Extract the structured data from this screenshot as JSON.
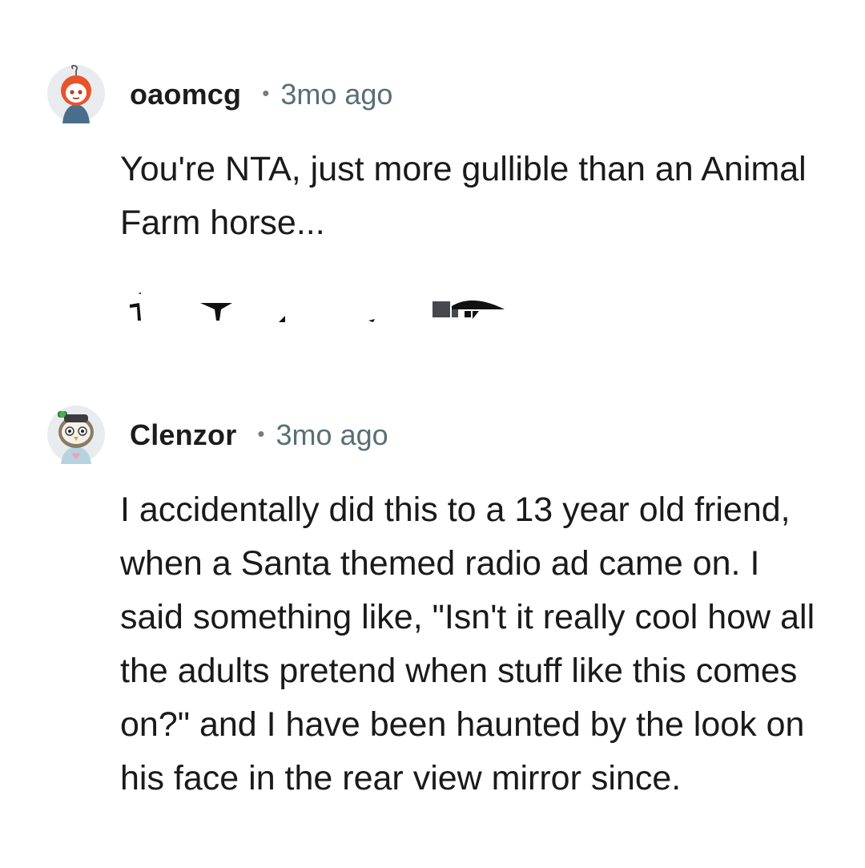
{
  "comments": [
    {
      "username": "oaomcg",
      "separator": "•",
      "timestamp": "3mo ago",
      "body": "You're NTA, just more gullible than an Animal Farm horse...",
      "avatar_icon": "snoo-avatar-red-hood-icon"
    },
    {
      "username": "Clenzor",
      "separator": "•",
      "timestamp": "3mo ago",
      "body": "I accidentally did this to a 13 year old friend, when a Santa themed radio ad came on. I said something like, \"Isn't it really cool how all the adults pretend when stuff like this comes on?\" and I have been haunted by the look on his face in the rear view mirror since.",
      "avatar_icon": "snoo-avatar-owl-mask-icon"
    }
  ],
  "colors": {
    "username": "#1c1c1c",
    "timestamp": "#576f76",
    "body": "#1a1a1b",
    "background": "#ffffff"
  }
}
